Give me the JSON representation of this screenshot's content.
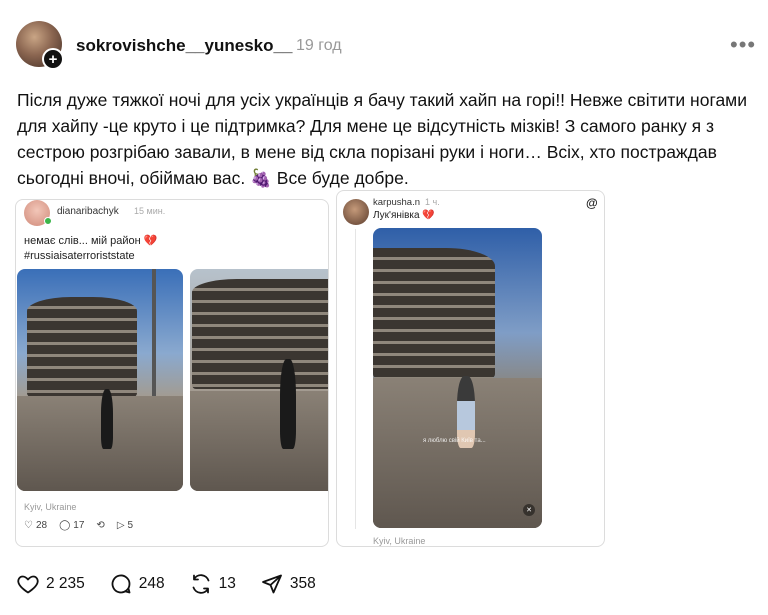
{
  "post": {
    "username": "sokrovishche__yunesko__",
    "time": "19 год",
    "more_label": "•••",
    "text_main": "Після дуже тяжкої ночі для усіх українців я бачу такий хайп на горі!! Невже світити ногами для хайпу -це круто і це підтримка? Для мене це відсутність мізків! З самого ранку я з сестрою розгрібаю завали, в мене від скла порізані руки і ноги… Всіх, хто постраждав сьогодні вночі, обіймаю вас.",
    "emoji": "🍇",
    "text_end": "Все буде добре."
  },
  "embed1": {
    "username": "dianaribachyk",
    "time": "15 мин.",
    "text_line1": "немає слів... мій район",
    "heart": "💔",
    "hashtag": "#russiaisaterroriststate",
    "location": "Kyiv, Ukraine",
    "likes": "28",
    "comments": "17",
    "shares": "5"
  },
  "embed2": {
    "username": "karpusha.n",
    "time": "1 ч.",
    "title": "Лук'янівка",
    "heart": "💔",
    "threads_logo": "@",
    "caption": "я люблю свій Київ та...",
    "location": "Kyiv, Ukraine"
  },
  "actions": {
    "likes": "2 235",
    "comments": "248",
    "reposts": "13",
    "shares": "358"
  }
}
